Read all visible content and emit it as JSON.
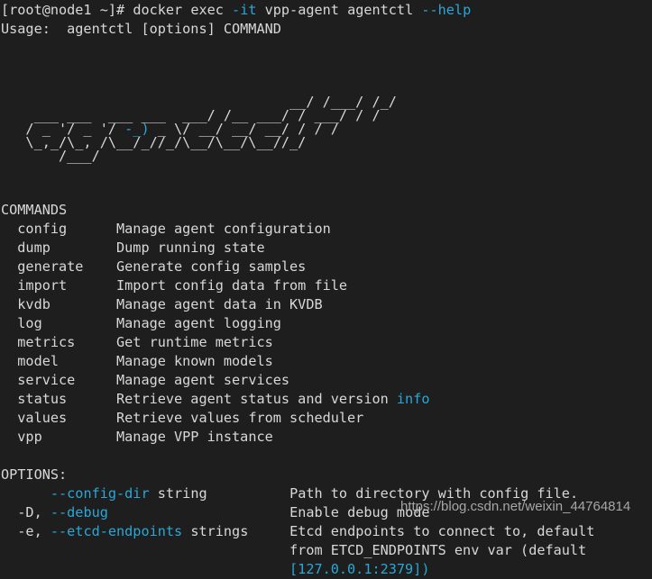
{
  "terminal": {
    "background_color": "#1e1e1e",
    "foreground_color": "#d8d8d8",
    "accent_color": "#29a8d8",
    "prompt": {
      "user_host": "[root@node1 ~]# ",
      "command_head": "docker exec ",
      "flag_it": "-it",
      "command_mid": " vpp-agent agentctl ",
      "flag_help": "--help"
    },
    "usage_line": "Usage:  agentctl [options] COMMAND",
    "banner": {
      "line1": "                                   __/ /___/ /_/",
      "line2": "    ___ ___  ___ ___  ___/ /__ ___/ / ___/ / /",
      "line3": "   / _ '/ _ '/ -_) _ \\/ __/ __/ __/ / / /",
      "line4": "   \\_,_/\\_, /\\__/_//_/\\__/\\__/\\__//_/",
      "line5": "       /___/",
      "cyan_fragment": "-_)"
    },
    "commands_header": "COMMANDS",
    "commands": [
      {
        "name": "config",
        "description": "Manage agent configuration"
      },
      {
        "name": "dump",
        "description": "Dump running state"
      },
      {
        "name": "generate",
        "description": "Generate config samples"
      },
      {
        "name": "import",
        "description": "Import config data from file"
      },
      {
        "name": "kvdb",
        "description": "Manage agent data in KVDB"
      },
      {
        "name": "log",
        "description": "Manage agent logging"
      },
      {
        "name": "metrics",
        "description": "Get runtime metrics"
      },
      {
        "name": "model",
        "description": "Manage known models"
      },
      {
        "name": "service",
        "description": "Manage agent services"
      },
      {
        "name": "status",
        "description": "Retrieve agent status and version ",
        "description_accent": "info"
      },
      {
        "name": "values",
        "description": "Retrieve values from scheduler"
      },
      {
        "name": "vpp",
        "description": "Manage VPP instance"
      }
    ],
    "options_header": "OPTIONS:",
    "options": [
      {
        "short": "",
        "long": "--config-dir",
        "type": "string",
        "description": "Path to directory with config file.",
        "description_cont": [],
        "default_value": ""
      },
      {
        "short": "-D,",
        "long": "--debug",
        "type": "",
        "description": "Enable debug mode",
        "description_cont": [],
        "default_value": ""
      },
      {
        "short": "-e,",
        "long": "--etcd-endpoints",
        "type": "strings",
        "description": "Etcd endpoints to connect to, default",
        "description_cont": [
          "from ETCD_ENDPOINTS env var (default"
        ],
        "default_value": "[127.0.0.1:2379])"
      }
    ]
  },
  "watermark": {
    "text": "https://blog.csdn.net/weixin_44764814"
  }
}
